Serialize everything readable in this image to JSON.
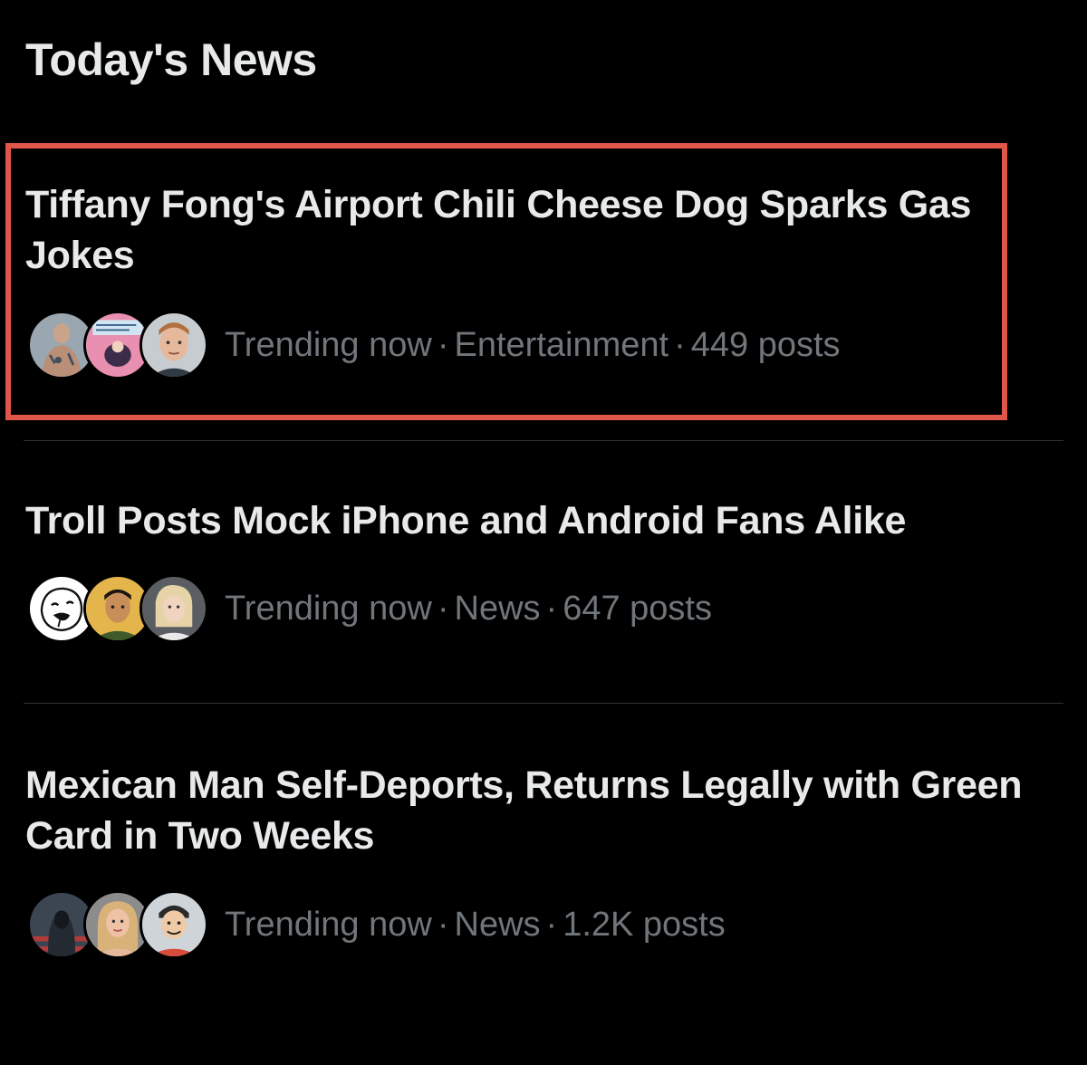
{
  "section": {
    "title": "Today's News"
  },
  "items": [
    {
      "headline": "Tiffany Fong's Airport Chili Cheese Dog Sparks Gas Jokes",
      "status": "Trending now",
      "category": "Entertainment",
      "posts": "449 posts",
      "highlighted": true
    },
    {
      "headline": "Troll Posts Mock iPhone and Android Fans Alike",
      "status": "Trending now",
      "category": "News",
      "posts": "647 posts",
      "highlighted": false
    },
    {
      "headline": "Mexican Man Self-Deports, Returns Legally with Green Card in Two Weeks",
      "status": "Trending now",
      "category": "News",
      "posts": "1.2K posts",
      "highlighted": false
    }
  ],
  "separator": "·",
  "colors": {
    "background": "#000000",
    "headline": "#e7e9ea",
    "meta": "#71767b",
    "divider": "#2f3336",
    "highlight_border": "#e0574a"
  }
}
